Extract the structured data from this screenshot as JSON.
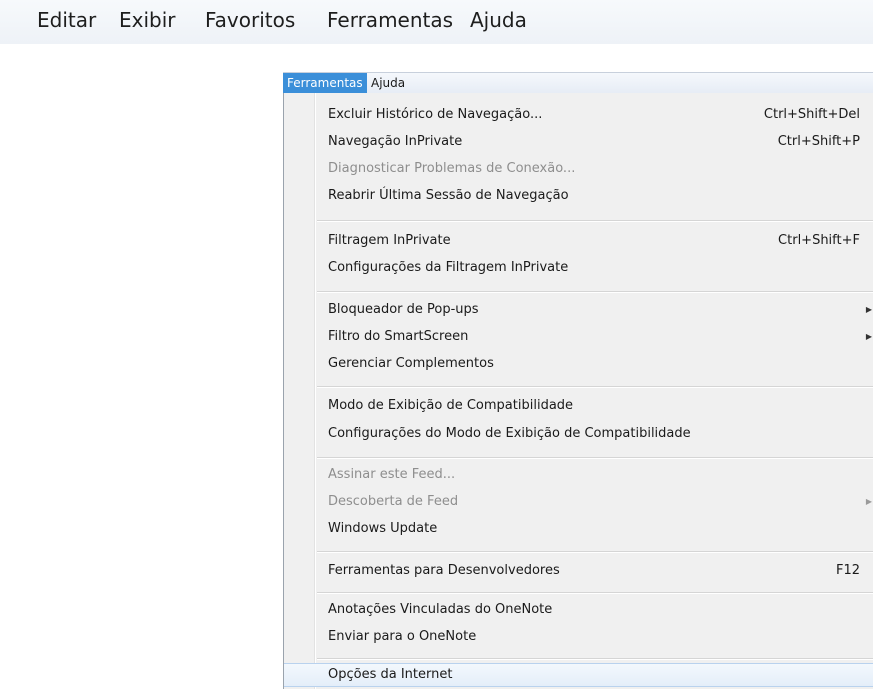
{
  "top_menubar": {
    "items": [
      "Editar",
      "Exibir",
      "Favoritos",
      "Ferramentas",
      "Ajuda"
    ]
  },
  "menubar": {
    "items": [
      {
        "label": "Ferramentas",
        "active": true
      },
      {
        "label": "Ajuda",
        "active": false
      }
    ]
  },
  "menu": {
    "items": [
      {
        "label": "Excluir Histórico de Navegação...",
        "shortcut": "Ctrl+Shift+Del"
      },
      {
        "label": "Navegação InPrivate",
        "shortcut": "Ctrl+Shift+P"
      },
      {
        "label": "Diagnosticar Problemas de Conexão...",
        "shortcut": "",
        "disabled": true
      },
      {
        "label": "Reabrir Última Sessão de Navegação",
        "shortcut": ""
      },
      {
        "label": "Filtragem InPrivate",
        "shortcut": "Ctrl+Shift+F"
      },
      {
        "label": "Configurações da Filtragem InPrivate",
        "shortcut": ""
      },
      {
        "label": "Bloqueador de Pop-ups",
        "shortcut": "",
        "submenu": true
      },
      {
        "label": "Filtro do SmartScreen",
        "shortcut": "",
        "submenu": true
      },
      {
        "label": "Gerenciar Complementos",
        "shortcut": ""
      },
      {
        "label": "Modo de Exibição de Compatibilidade",
        "shortcut": ""
      },
      {
        "label": "Configurações do Modo de Exibição de Compatibilidade",
        "shortcut": ""
      },
      {
        "label": "Assinar este Feed...",
        "shortcut": "",
        "disabled": true
      },
      {
        "label": "Descoberta de Feed",
        "shortcut": "",
        "disabled": true,
        "submenu": true
      },
      {
        "label": "Windows Update",
        "shortcut": ""
      },
      {
        "label": "Ferramentas para Desenvolvedores",
        "shortcut": "F12"
      },
      {
        "label": "Anotações Vinculadas do OneNote",
        "shortcut": ""
      },
      {
        "label": "Enviar para o OneNote",
        "shortcut": ""
      },
      {
        "label": "Opções da Internet",
        "shortcut": "",
        "highlighted": true
      }
    ],
    "submenu_arrow_icon": "chevron-right-icon"
  },
  "colors": {
    "menubar_active": "#3b8fd9",
    "menu_background": "#f0f0f0",
    "disabled_text": "#8e8e8e"
  }
}
